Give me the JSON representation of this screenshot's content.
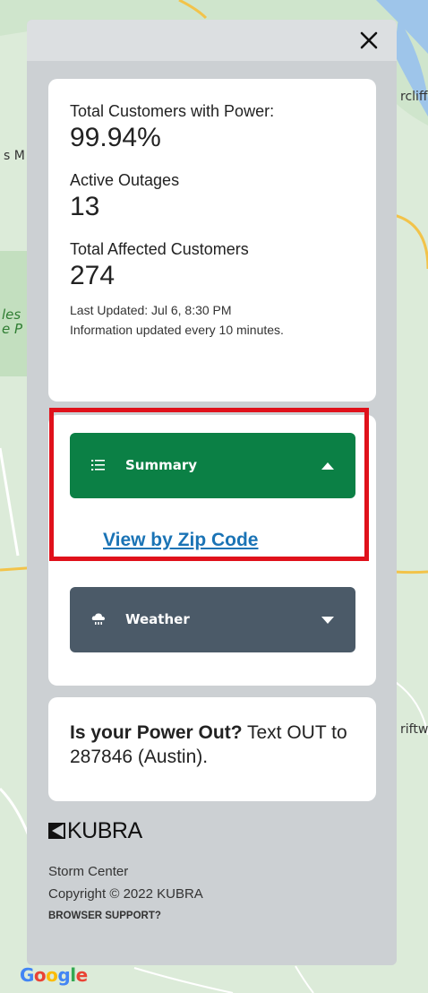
{
  "map": {
    "labels": {
      "top_right": "rcliff",
      "left": "s M",
      "park_line1": "les",
      "park_line2": "e P",
      "right_lower": "riftw"
    },
    "google_logo": [
      "G",
      "o",
      "o",
      "g",
      "l",
      "e"
    ],
    "google_colors": [
      "#4285F4",
      "#EA4335",
      "#FBBC05",
      "#4285F4",
      "#34A853",
      "#EA4335"
    ]
  },
  "panel": {
    "close_icon": "close-icon",
    "stats": {
      "customers_label": "Total Customers with Power:",
      "customers_value": "99.94%",
      "outages_label": "Active Outages",
      "outages_value": "13",
      "affected_label": "Total Affected Customers",
      "affected_value": "274",
      "last_updated": "Last Updated:  Jul 6, 8:30 PM",
      "update_interval": "Information updated every 10 minutes."
    },
    "summary": {
      "label": "Summary",
      "icon": "list-icon",
      "expanded": true,
      "color": "#0b8045",
      "link": "View by Zip Code"
    },
    "weather": {
      "label": "Weather",
      "icon": "storm-cloud-icon",
      "expanded": false,
      "color": "#4b5a68"
    },
    "power_out": {
      "bold": "Is your Power Out?",
      "text": " Text OUT to 287846 (Austin)."
    },
    "footer": {
      "brand": "KUBRA",
      "app_name": "Storm Center",
      "copyright": "Copyright © 2022 KUBRA",
      "browser_support": "BROWSER SUPPORT?"
    }
  },
  "highlight_color": "#e0111b"
}
